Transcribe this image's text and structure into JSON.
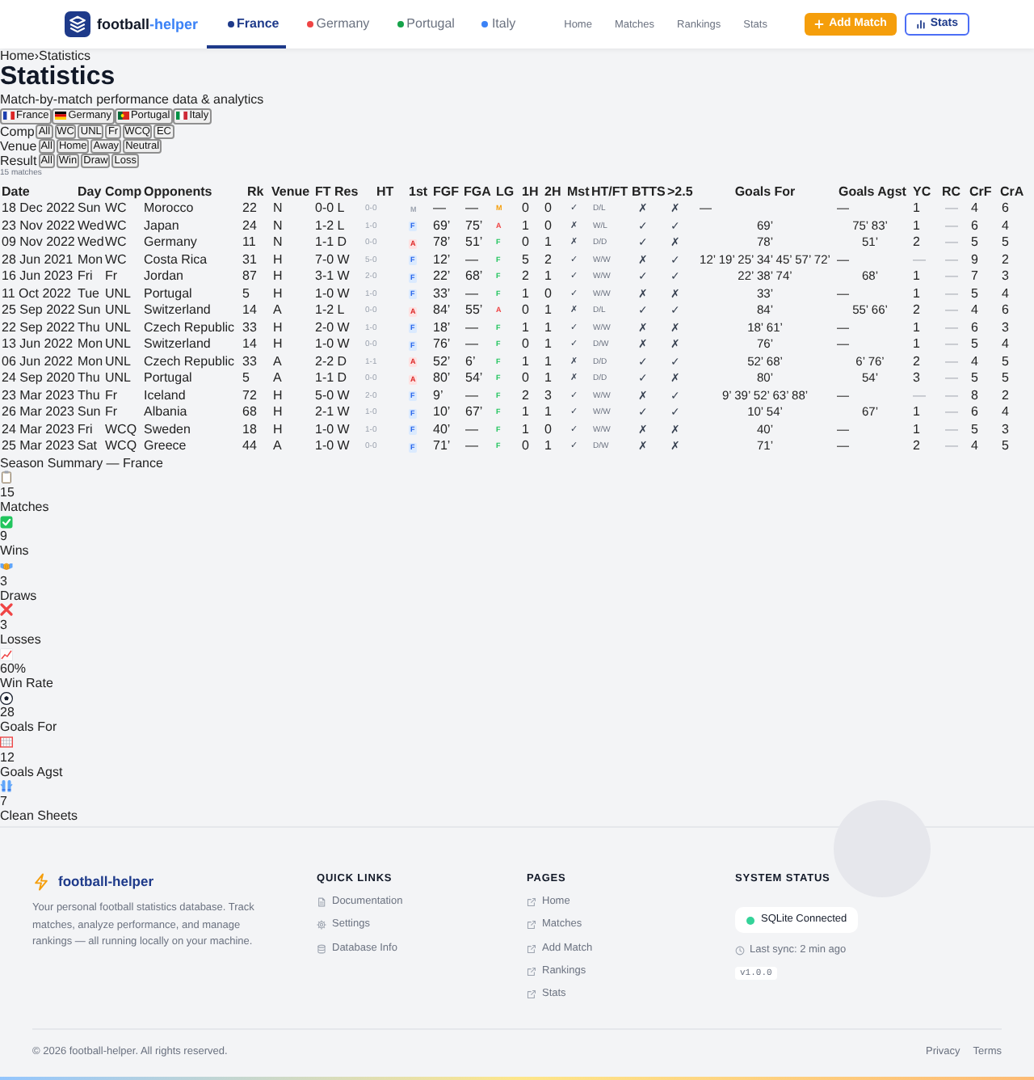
{
  "nav": {
    "brand": {
      "text": "football",
      "accent": "-helper"
    },
    "teams": [
      {
        "label": "France",
        "color": "#1e3a8a",
        "selected": true
      },
      {
        "label": "Germany",
        "color": "#ef4444",
        "selected": false
      },
      {
        "label": "Portugal",
        "color": "#16a34a",
        "selected": false
      },
      {
        "label": "Italy",
        "color": "#3b82f6",
        "selected": false
      }
    ],
    "links": [
      "Home",
      "Matches",
      "Rankings",
      "Stats"
    ],
    "actions": [
      {
        "label": "Add Match",
        "kind": "primary"
      },
      {
        "label": "Stats",
        "kind": "outline"
      }
    ]
  },
  "breadcrumb": {
    "items": [
      "Home",
      "Statistics"
    ],
    "separator": "›"
  },
  "title": "Statistics",
  "subtitle": "Match-by-match performance data & analytics",
  "country_filters": [
    {
      "label": "France",
      "kind": "fr"
    },
    {
      "label": "Germany",
      "kind": "de"
    },
    {
      "label": "Portugal",
      "kind": "pt"
    },
    {
      "label": "Italy",
      "kind": "it"
    }
  ],
  "filters": [
    {
      "label": "Comp",
      "options": [
        "All",
        "WC",
        "UNL",
        "Fr",
        "WCQ",
        "EC"
      ]
    },
    {
      "label": "Venue",
      "options": [
        "All",
        "Home",
        "Away",
        "Neutral"
      ]
    },
    {
      "label": "Result",
      "options": [
        "All",
        "Win",
        "Draw",
        "Loss"
      ]
    }
  ],
  "match_count": "15 matches",
  "table": {
    "columns": [
      "Date",
      "Day",
      "Comp",
      "Opponents",
      "Rk",
      "Venue",
      "FT Res",
      "HT",
      "1st",
      "FGF",
      "FGA",
      "LG",
      "1H",
      "2H",
      "Mst",
      "HT/FT",
      "BTTS",
      ">2.5",
      "Goals For",
      "Goals Agst",
      "YC",
      "RC",
      "CrF",
      "CrA"
    ],
    "rows": [
      {
        "date": "18 Dec 2022",
        "day": "Sun",
        "comp": "WC",
        "opponent": "Morocco",
        "rank": "22",
        "venue": "N",
        "ft": "0-0 L",
        "ht": "0-0",
        "first": {
          "text": "M",
          "kind": "none"
        },
        "fgf": "—",
        "fga": "—",
        "lg": {
          "text": "M",
          "kind": "none"
        },
        "h1": "0",
        "h2": "0",
        "mst": "✓",
        "ht_ft": "D/L",
        "btts": "✗",
        "over25": "✗",
        "goals_for": {
          "text": "—",
          "empty": true
        },
        "goals_agst": {
          "text": "—",
          "empty": true
        },
        "yc": {
          "text": "1",
          "empty": false
        },
        "rc": {
          "text": "—",
          "empty": true
        },
        "crf": "4",
        "cra": "6"
      },
      {
        "date": "23 Nov 2022",
        "day": "Wed",
        "comp": "WC",
        "opponent": "Japan",
        "rank": "24",
        "venue": "N",
        "ft": "1-2 L",
        "ht": "1-0",
        "first": {
          "text": "F",
          "kind": "for"
        },
        "fgf": "69’",
        "fga": "75’",
        "lg": {
          "text": "A",
          "kind": "against"
        },
        "h1": "1",
        "h2": "0",
        "mst": "✗",
        "ht_ft": "W/L",
        "btts": "✓",
        "over25": "✓",
        "goals_for": {
          "text": "69’",
          "empty": false
        },
        "goals_agst": {
          "text": "75’ 83’",
          "empty": false
        },
        "yc": {
          "text": "1",
          "empty": false
        },
        "rc": {
          "text": "—",
          "empty": true
        },
        "crf": "6",
        "cra": "4"
      },
      {
        "date": "09 Nov 2022",
        "day": "Wed",
        "comp": "WC",
        "opponent": "Germany",
        "rank": "11",
        "venue": "N",
        "ft": "1-1 D",
        "ht": "0-0",
        "first": {
          "text": "A",
          "kind": "against"
        },
        "fgf": "78’",
        "fga": "51’",
        "lg": {
          "text": "F",
          "kind": "for"
        },
        "h1": "0",
        "h2": "1",
        "mst": "✗",
        "ht_ft": "D/D",
        "btts": "✓",
        "over25": "✗",
        "goals_for": {
          "text": "78’",
          "empty": false
        },
        "goals_agst": {
          "text": "51’",
          "empty": false
        },
        "yc": {
          "text": "2",
          "empty": false
        },
        "rc": {
          "text": "—",
          "empty": true
        },
        "crf": "5",
        "cra": "5"
      },
      {
        "date": "28 Jun 2021",
        "day": "Mon",
        "comp": "WC",
        "opponent": "Costa Rica",
        "rank": "31",
        "venue": "H",
        "ft": "7-0 W",
        "ht": "5-0",
        "first": {
          "text": "F",
          "kind": "for"
        },
        "fgf": "12’",
        "fga": "—",
        "lg": {
          "text": "F",
          "kind": "for"
        },
        "h1": "5",
        "h2": "2",
        "mst": "✓",
        "ht_ft": "W/W",
        "btts": "✗",
        "over25": "✓",
        "goals_for": {
          "text": "12’ 19’ 25’ 34’ 45’ 57’ 72’",
          "empty": false
        },
        "goals_agst": {
          "text": "—",
          "empty": true
        },
        "yc": {
          "text": "—",
          "empty": true
        },
        "rc": {
          "text": "—",
          "empty": true
        },
        "crf": "9",
        "cra": "2"
      },
      {
        "date": "16 Jun 2023",
        "day": "Fri",
        "comp": "Fr",
        "opponent": "Jordan",
        "rank": "87",
        "venue": "H",
        "ft": "3-1 W",
        "ht": "2-0",
        "first": {
          "text": "F",
          "kind": "for"
        },
        "fgf": "22’",
        "fga": "68’",
        "lg": {
          "text": "F",
          "kind": "for"
        },
        "h1": "2",
        "h2": "1",
        "mst": "✓",
        "ht_ft": "W/W",
        "btts": "✓",
        "over25": "✓",
        "goals_for": {
          "text": "22’ 38’ 74’",
          "empty": false
        },
        "goals_agst": {
          "text": "68’",
          "empty": false
        },
        "yc": {
          "text": "1",
          "empty": false
        },
        "rc": {
          "text": "—",
          "empty": true
        },
        "crf": "7",
        "cra": "3"
      },
      {
        "date": "11 Oct 2022",
        "day": "Tue",
        "comp": "UNL",
        "opponent": "Portugal",
        "rank": "5",
        "venue": "H",
        "ft": "1-0 W",
        "ht": "1-0",
        "first": {
          "text": "F",
          "kind": "for"
        },
        "fgf": "33’",
        "fga": "—",
        "lg": {
          "text": "F",
          "kind": "for"
        },
        "h1": "1",
        "h2": "0",
        "mst": "✓",
        "ht_ft": "W/W",
        "btts": "✗",
        "over25": "✗",
        "goals_for": {
          "text": "33’",
          "empty": false
        },
        "goals_agst": {
          "text": "—",
          "empty": true
        },
        "yc": {
          "text": "1",
          "empty": false
        },
        "rc": {
          "text": "—",
          "empty": true
        },
        "crf": "5",
        "cra": "4"
      },
      {
        "date": "25 Sep 2022",
        "day": "Sun",
        "comp": "UNL",
        "opponent": "Switzerland",
        "rank": "14",
        "venue": "A",
        "ft": "1-2 L",
        "ht": "0-0",
        "first": {
          "text": "A",
          "kind": "against"
        },
        "fgf": "84’",
        "fga": "55’",
        "lg": {
          "text": "A",
          "kind": "against"
        },
        "h1": "0",
        "h2": "1",
        "mst": "✗",
        "ht_ft": "D/L",
        "btts": "✓",
        "over25": "✓",
        "goals_for": {
          "text": "84’",
          "empty": false
        },
        "goals_agst": {
          "text": "55’ 66’",
          "empty": false
        },
        "yc": {
          "text": "2",
          "empty": false
        },
        "rc": {
          "text": "—",
          "empty": true
        },
        "crf": "4",
        "cra": "6"
      },
      {
        "date": "22 Sep 2022",
        "day": "Thu",
        "comp": "UNL",
        "opponent": "Czech Republic",
        "rank": "33",
        "venue": "H",
        "ft": "2-0 W",
        "ht": "1-0",
        "first": {
          "text": "F",
          "kind": "for"
        },
        "fgf": "18’",
        "fga": "—",
        "lg": {
          "text": "F",
          "kind": "for"
        },
        "h1": "1",
        "h2": "1",
        "mst": "✓",
        "ht_ft": "W/W",
        "btts": "✗",
        "over25": "✗",
        "goals_for": {
          "text": "18’ 61’",
          "empty": false
        },
        "goals_agst": {
          "text": "—",
          "empty": true
        },
        "yc": {
          "text": "1",
          "empty": false
        },
        "rc": {
          "text": "—",
          "empty": true
        },
        "crf": "6",
        "cra": "3"
      },
      {
        "date": "13 Jun 2022",
        "day": "Mon",
        "comp": "UNL",
        "opponent": "Switzerland",
        "rank": "14",
        "venue": "H",
        "ft": "1-0 W",
        "ht": "0-0",
        "first": {
          "text": "F",
          "kind": "for"
        },
        "fgf": "76’",
        "fga": "—",
        "lg": {
          "text": "F",
          "kind": "for"
        },
        "h1": "0",
        "h2": "1",
        "mst": "✓",
        "ht_ft": "D/W",
        "btts": "✗",
        "over25": "✗",
        "goals_for": {
          "text": "76’",
          "empty": false
        },
        "goals_agst": {
          "text": "—",
          "empty": true
        },
        "yc": {
          "text": "1",
          "empty": false
        },
        "rc": {
          "text": "—",
          "empty": true
        },
        "crf": "5",
        "cra": "4"
      },
      {
        "date": "06 Jun 2022",
        "day": "Mon",
        "comp": "UNL",
        "opponent": "Czech Republic",
        "rank": "33",
        "venue": "A",
        "ft": "2-2 D",
        "ht": "1-1",
        "first": {
          "text": "A",
          "kind": "against"
        },
        "fgf": "52’",
        "fga": "6’",
        "lg": {
          "text": "F",
          "kind": "for"
        },
        "h1": "1",
        "h2": "1",
        "mst": "✗",
        "ht_ft": "D/D",
        "btts": "✓",
        "over25": "✓",
        "goals_for": {
          "text": "52’ 68’",
          "empty": false
        },
        "goals_agst": {
          "text": "6’ 76’",
          "empty": false
        },
        "yc": {
          "text": "2",
          "empty": false
        },
        "rc": {
          "text": "—",
          "empty": true
        },
        "crf": "4",
        "cra": "5"
      },
      {
        "date": "24 Sep 2020",
        "day": "Thu",
        "comp": "UNL",
        "opponent": "Portugal",
        "rank": "5",
        "venue": "A",
        "ft": "1-1 D",
        "ht": "0-0",
        "first": {
          "text": "A",
          "kind": "against"
        },
        "fgf": "80’",
        "fga": "54’",
        "lg": {
          "text": "F",
          "kind": "for"
        },
        "h1": "0",
        "h2": "1",
        "mst": "✗",
        "ht_ft": "D/D",
        "btts": "✓",
        "over25": "✗",
        "goals_for": {
          "text": "80’",
          "empty": false
        },
        "goals_agst": {
          "text": "54’",
          "empty": false
        },
        "yc": {
          "text": "3",
          "empty": false
        },
        "rc": {
          "text": "—",
          "empty": true
        },
        "crf": "5",
        "cra": "5"
      },
      {
        "date": "23 Mar 2023",
        "day": "Thu",
        "comp": "Fr",
        "opponent": "Iceland",
        "rank": "72",
        "venue": "H",
        "ft": "5-0 W",
        "ht": "2-0",
        "first": {
          "text": "F",
          "kind": "for"
        },
        "fgf": "9’",
        "fga": "—",
        "lg": {
          "text": "F",
          "kind": "for"
        },
        "h1": "2",
        "h2": "3",
        "mst": "✓",
        "ht_ft": "W/W",
        "btts": "✗",
        "over25": "✓",
        "goals_for": {
          "text": "9’ 39’ 52’ 63’ 88’",
          "empty": false
        },
        "goals_agst": {
          "text": "—",
          "empty": true
        },
        "yc": {
          "text": "—",
          "empty": true
        },
        "rc": {
          "text": "—",
          "empty": true
        },
        "crf": "8",
        "cra": "2"
      },
      {
        "date": "26 Mar 2023",
        "day": "Sun",
        "comp": "Fr",
        "opponent": "Albania",
        "rank": "68",
        "venue": "H",
        "ft": "2-1 W",
        "ht": "1-0",
        "first": {
          "text": "F",
          "kind": "for"
        },
        "fgf": "10’",
        "fga": "67’",
        "lg": {
          "text": "F",
          "kind": "for"
        },
        "h1": "1",
        "h2": "1",
        "mst": "✓",
        "ht_ft": "W/W",
        "btts": "✓",
        "over25": "✓",
        "goals_for": {
          "text": "10’ 54’",
          "empty": false
        },
        "goals_agst": {
          "text": "67’",
          "empty": false
        },
        "yc": {
          "text": "1",
          "empty": false
        },
        "rc": {
          "text": "—",
          "empty": true
        },
        "crf": "6",
        "cra": "4"
      },
      {
        "date": "24 Mar 2023",
        "day": "Fri",
        "comp": "WCQ",
        "opponent": "Sweden",
        "rank": "18",
        "venue": "H",
        "ft": "1-0 W",
        "ht": "1-0",
        "first": {
          "text": "F",
          "kind": "for"
        },
        "fgf": "40’",
        "fga": "—",
        "lg": {
          "text": "F",
          "kind": "for"
        },
        "h1": "1",
        "h2": "0",
        "mst": "✓",
        "ht_ft": "W/W",
        "btts": "✗",
        "over25": "✗",
        "goals_for": {
          "text": "40’",
          "empty": false
        },
        "goals_agst": {
          "text": "—",
          "empty": true
        },
        "yc": {
          "text": "1",
          "empty": false
        },
        "rc": {
          "text": "—",
          "empty": true
        },
        "crf": "5",
        "cra": "3"
      },
      {
        "date": "25 Mar 2023",
        "day": "Sat",
        "comp": "WCQ",
        "opponent": "Greece",
        "rank": "44",
        "venue": "A",
        "ft": "1-0 W",
        "ht": "0-0",
        "first": {
          "text": "F",
          "kind": "for"
        },
        "fgf": "71’",
        "fga": "—",
        "lg": {
          "text": "F",
          "kind": "for"
        },
        "h1": "0",
        "h2": "1",
        "mst": "✓",
        "ht_ft": "D/W",
        "btts": "✗",
        "over25": "✗",
        "goals_for": {
          "text": "71’",
          "empty": false
        },
        "goals_agst": {
          "text": "—",
          "empty": true
        },
        "yc": {
          "text": "2",
          "empty": false
        },
        "rc": {
          "text": "—",
          "empty": true
        },
        "crf": "4",
        "cra": "5"
      }
    ]
  },
  "summary": {
    "title": "Season Summary — France",
    "stats": [
      {
        "kind": "clipboard",
        "value": "15",
        "label": "Matches"
      },
      {
        "kind": "check",
        "value": "9",
        "label": "Wins"
      },
      {
        "kind": "handshake",
        "value": "3",
        "label": "Draws"
      },
      {
        "kind": "cross",
        "value": "3",
        "label": "Losses"
      },
      {
        "kind": "chart",
        "value": "60%",
        "label": "Win Rate"
      },
      {
        "kind": "ball",
        "value": "28",
        "label": "Goals For"
      },
      {
        "kind": "net",
        "value": "12",
        "label": "Goals Agst"
      },
      {
        "kind": "gloves",
        "value": "7",
        "label": "Clean Sheets"
      }
    ]
  },
  "footer": {
    "brand": "football-helper",
    "description": "Your personal football statistics database. Track matches, analyze performance, and manage rankings — all running locally on your machine.",
    "link_groups": [
      {
        "title": "QUICK LINKS",
        "links": [
          {
            "label": "Documentation",
            "kind": "file"
          },
          {
            "label": "Settings",
            "kind": "gear"
          },
          {
            "label": "Database Info",
            "kind": "database"
          }
        ]
      },
      {
        "title": "PAGES",
        "links": [
          {
            "label": "Home",
            "kind": "external"
          },
          {
            "label": "Matches",
            "kind": "external"
          },
          {
            "label": "Add Match",
            "kind": "external"
          },
          {
            "label": "Rankings",
            "kind": "external"
          },
          {
            "label": "Stats",
            "kind": "external"
          }
        ]
      }
    ],
    "status": {
      "title": "SYSTEM STATUS",
      "connection": "SQLite Connected",
      "connected": true,
      "last_sync": "Last sync: 2 min ago",
      "version": "v1.0.0"
    },
    "copyright": "© 2026 football-helper. All rights reserved.",
    "legal_links": [
      "Privacy",
      "Terms"
    ]
  }
}
